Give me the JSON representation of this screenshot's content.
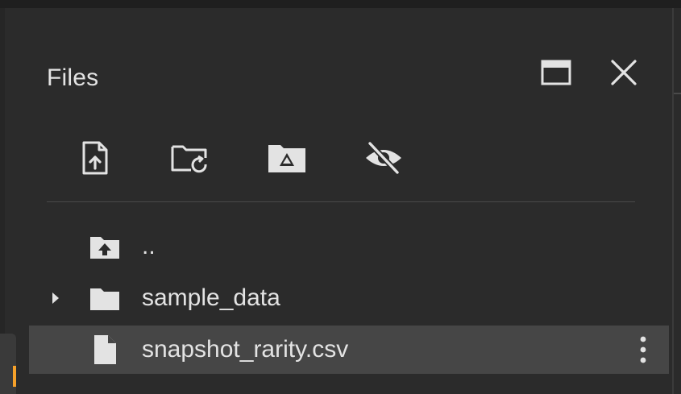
{
  "panel": {
    "title": "Files"
  },
  "header_actions": [
    {
      "name": "move-to-tab",
      "icon": "tab-window-icon"
    },
    {
      "name": "close",
      "icon": "close-icon"
    }
  ],
  "toolbar": [
    {
      "name": "upload",
      "icon": "file-upload-icon"
    },
    {
      "name": "refresh",
      "icon": "folder-refresh-icon"
    },
    {
      "name": "mount-drive",
      "icon": "drive-folder-icon"
    },
    {
      "name": "toggle-hidden",
      "icon": "eye-off-icon"
    }
  ],
  "tree": {
    "parent": {
      "label": "..",
      "icon": "folder-up-icon"
    },
    "items": [
      {
        "label": "sample_data",
        "type": "folder",
        "icon": "folder-icon",
        "expandable": true
      },
      {
        "label": "snapshot_rarity.csv",
        "type": "file",
        "icon": "file-icon",
        "selected": true
      }
    ]
  },
  "colors": {
    "background": "#2b2b2b",
    "text": "#e3e3e3",
    "selected_row": "#464646",
    "accent": "#f6a12a"
  }
}
